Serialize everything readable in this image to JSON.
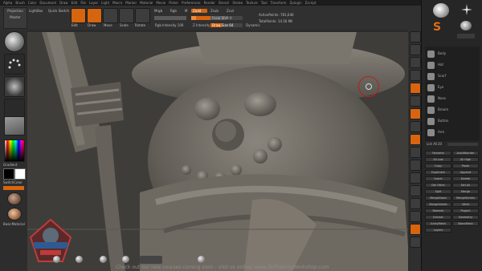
{
  "menu": [
    "Alpha",
    "Brush",
    "Color",
    "Document",
    "Draw",
    "Edit",
    "File",
    "Layer",
    "Light",
    "Macro",
    "Marker",
    "Material",
    "Movie",
    "Picker",
    "Preferences",
    "Render",
    "Stencil",
    "Stroke",
    "Texture",
    "Tool",
    "Transform",
    "Zplugin",
    "Zscript"
  ],
  "toolbar": {
    "projection_label": "Projection Master",
    "lightbox_label": "LightBox",
    "quick_sketch_label": "Quick Sketch",
    "edit_label": "Edit",
    "draw_label": "Draw",
    "move_label": "Move",
    "scale_label": "Scale",
    "rotate_label": "Rotate",
    "mrgb_label": "Mrgb",
    "rgb_label": "Rgb",
    "m_label": "M",
    "zadd_label": "Zadd",
    "zsub_label": "Zsub",
    "zcut_label": "Zcut",
    "rgb_intensity_label": "Rgb Intensity 100",
    "z_intensity_label": "Z Intensity 5",
    "focal_shift_label": "Focal Shift 0",
    "draw_size_label": "Draw Size 64",
    "dynamic_label": "Dynamic",
    "active_points_label": "ActivePoints: 781,646",
    "total_points_label": "TotalPoints: 14.56 Mil"
  },
  "left": {
    "texture_off_label": "TextureOff",
    "switch_color_label": "SwitchColor",
    "gradient_label": "Gradient",
    "matcap_label": "BasicMaterial"
  },
  "tray": {
    "subtools": [
      "Body",
      "Hat",
      "Scarf",
      "Eye",
      "Nose",
      "Broom",
      "Button",
      "Arm"
    ],
    "list_all_label": "List All",
    "count": "20",
    "panel_items": [
      "Rename",
      "AutoReorder",
      "All Low",
      "All High",
      "Copy",
      "Paste",
      "Duplicate",
      "Append",
      "Insert",
      "Delete",
      "Del Other",
      "Del All",
      "Split",
      "Merge",
      "MergeDown",
      "MergeSimilar",
      "MergeVisible",
      "Weld",
      "Remesh",
      "Project",
      "Extract",
      "Geometry",
      "ArrayMesh",
      "NanoMesh",
      "Layers"
    ]
  },
  "bottom": {
    "notice": "Check out our new courses coming soon - visit us online: www.3DTrainingWorkshop.com"
  },
  "colors": {
    "accent": "#d7640f",
    "bg": "#2a2a2a",
    "clay": "#6f6a61"
  }
}
